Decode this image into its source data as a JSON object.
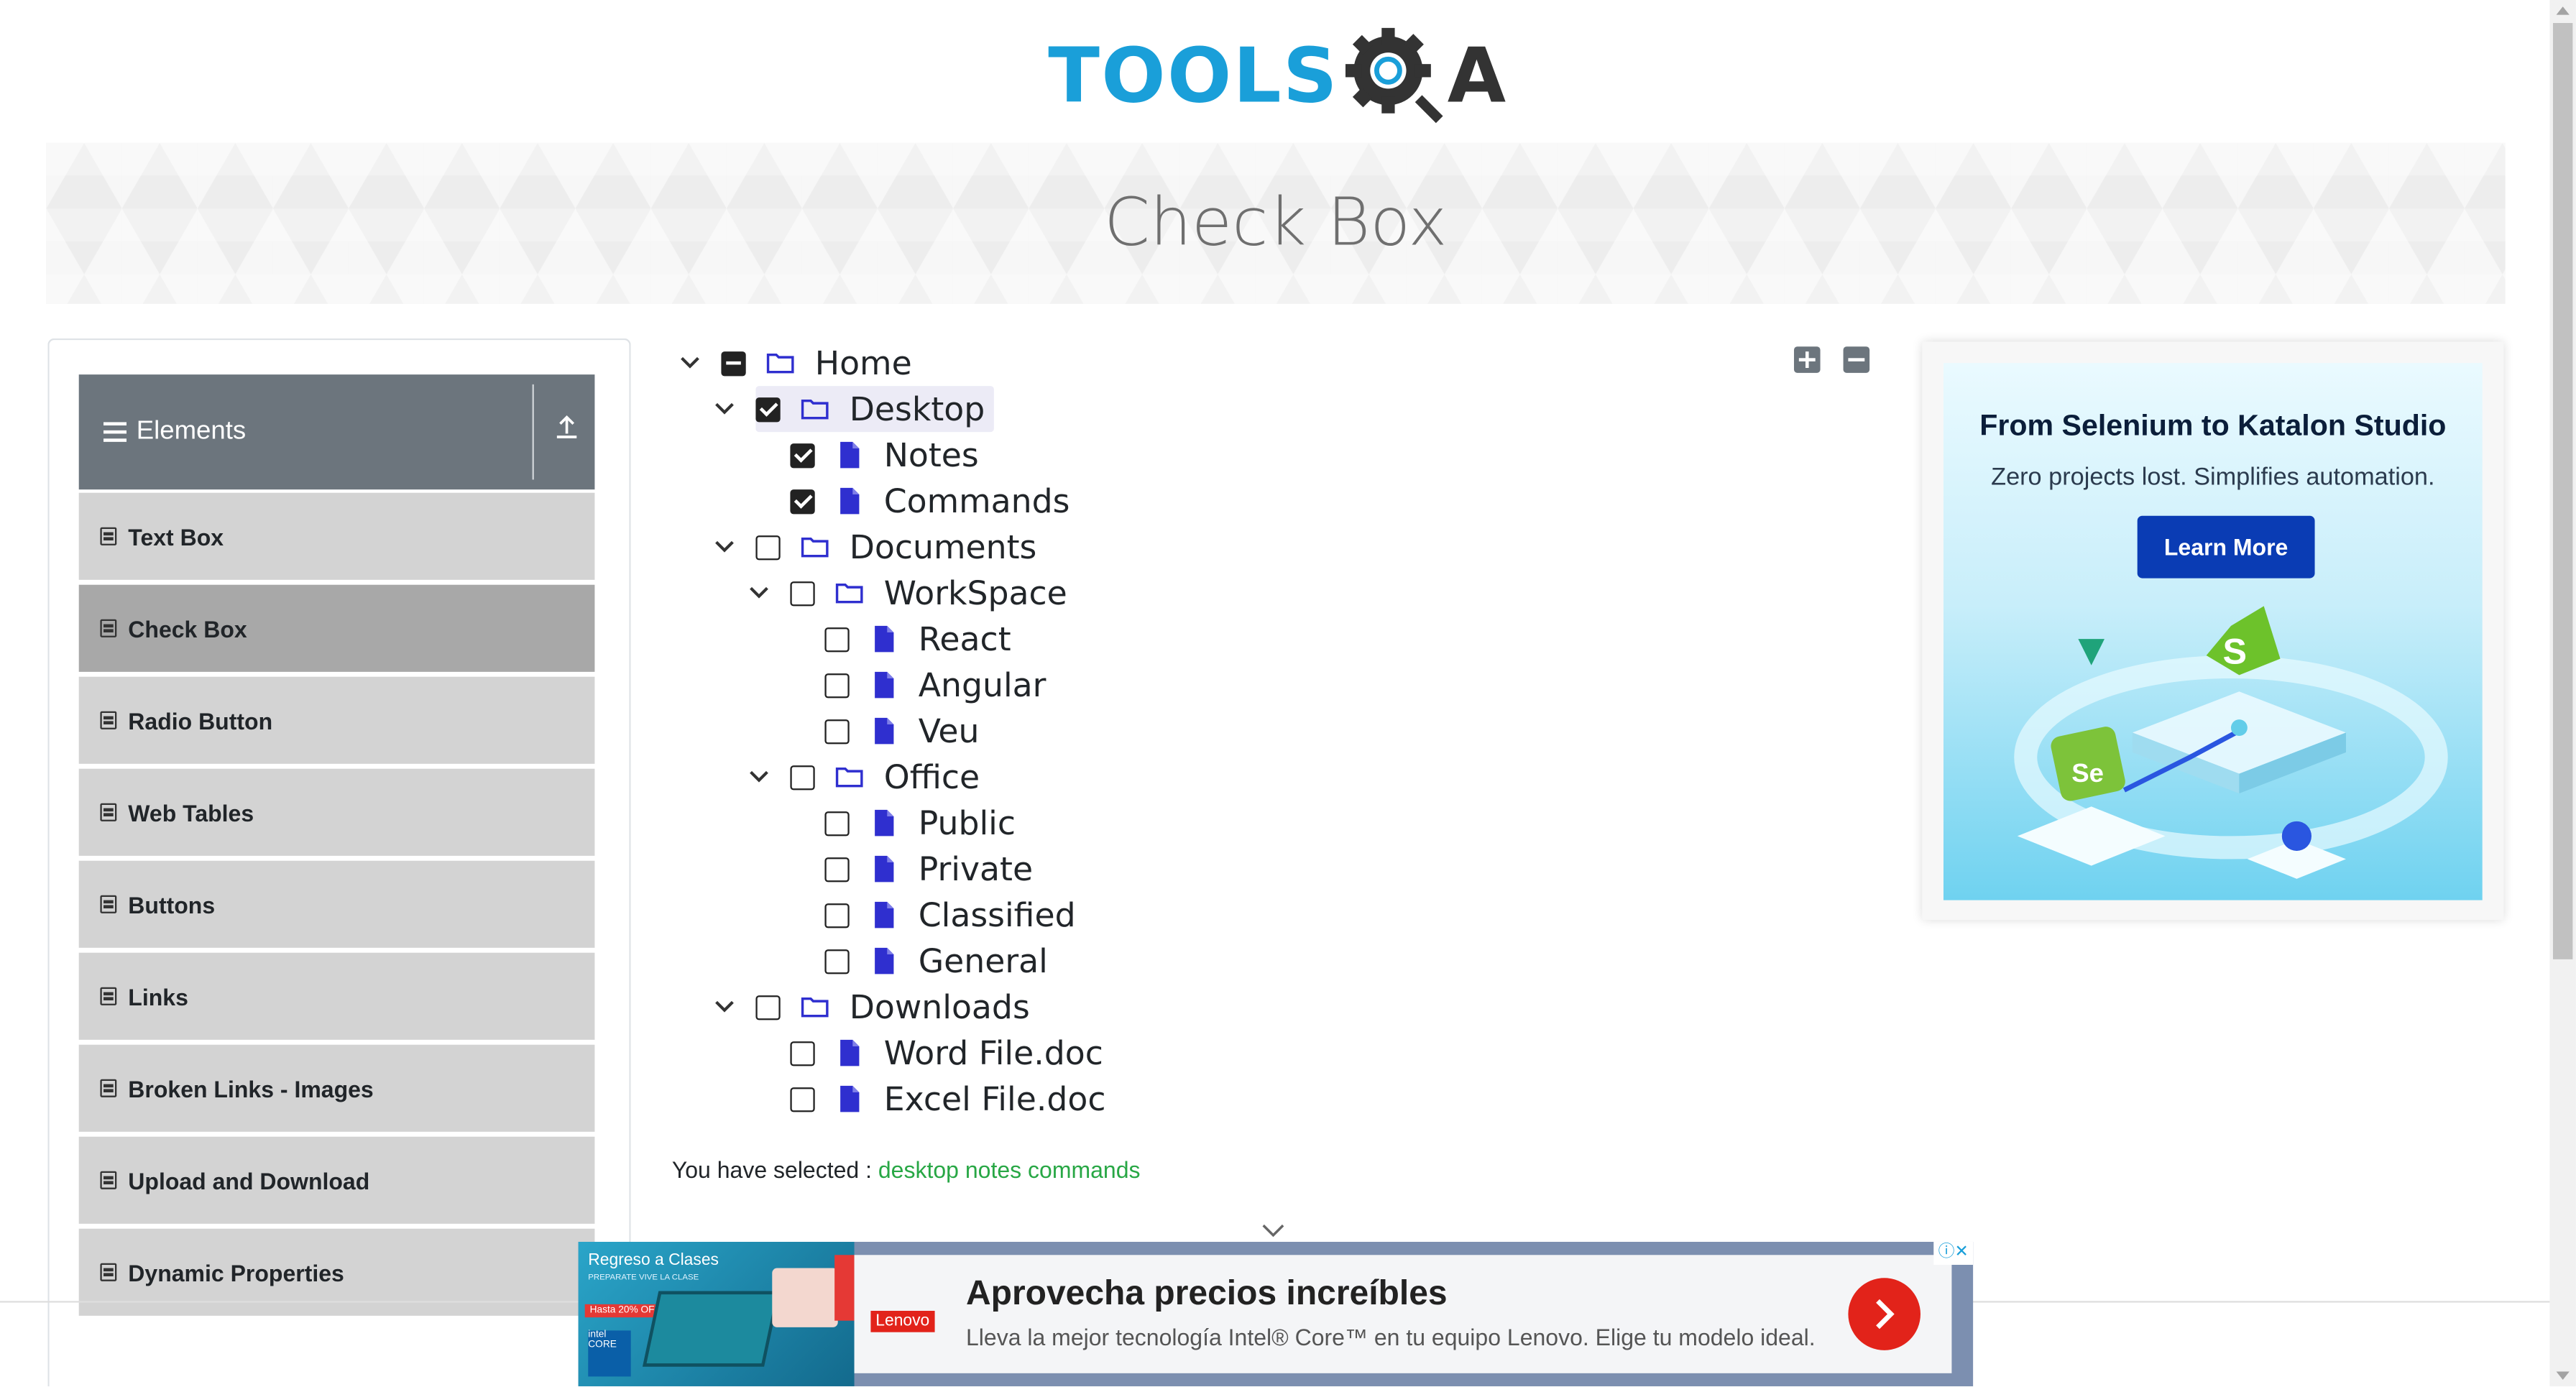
{
  "logo": {
    "tools": "TOOLS",
    "a": "A"
  },
  "banner": {
    "title": "Check Box"
  },
  "sidebar": {
    "header": "Elements",
    "items": [
      {
        "label": "Text Box",
        "active": false
      },
      {
        "label": "Check Box",
        "active": true
      },
      {
        "label": "Radio Button",
        "active": false
      },
      {
        "label": "Web Tables",
        "active": false
      },
      {
        "label": "Buttons",
        "active": false
      },
      {
        "label": "Links",
        "active": false
      },
      {
        "label": "Broken Links - Images",
        "active": false
      },
      {
        "label": "Upload and Download",
        "active": false
      },
      {
        "label": "Dynamic Properties",
        "active": false
      }
    ]
  },
  "tree": {
    "expand_all_icon": "plus-square-icon",
    "collapse_all_icon": "minus-square-icon",
    "nodes": [
      {
        "label": "Home",
        "depth": 0,
        "state": "half",
        "type": "folder",
        "expanded": true
      },
      {
        "label": "Desktop",
        "depth": 1,
        "state": "checked",
        "type": "folder",
        "expanded": true,
        "highlight": true
      },
      {
        "label": "Notes",
        "depth": 2,
        "state": "checked",
        "type": "file"
      },
      {
        "label": "Commands",
        "depth": 2,
        "state": "checked",
        "type": "file"
      },
      {
        "label": "Documents",
        "depth": 1,
        "state": "unchecked",
        "type": "folder",
        "expanded": true
      },
      {
        "label": "WorkSpace",
        "depth": 2,
        "state": "unchecked",
        "type": "folder",
        "expanded": true
      },
      {
        "label": "React",
        "depth": 3,
        "state": "unchecked",
        "type": "file"
      },
      {
        "label": "Angular",
        "depth": 3,
        "state": "unchecked",
        "type": "file"
      },
      {
        "label": "Veu",
        "depth": 3,
        "state": "unchecked",
        "type": "file"
      },
      {
        "label": "Office",
        "depth": 2,
        "state": "unchecked",
        "type": "folder",
        "expanded": true
      },
      {
        "label": "Public",
        "depth": 3,
        "state": "unchecked",
        "type": "file"
      },
      {
        "label": "Private",
        "depth": 3,
        "state": "unchecked",
        "type": "file"
      },
      {
        "label": "Classified",
        "depth": 3,
        "state": "unchecked",
        "type": "file"
      },
      {
        "label": "General",
        "depth": 3,
        "state": "unchecked",
        "type": "file"
      },
      {
        "label": "Downloads",
        "depth": 1,
        "state": "unchecked",
        "type": "folder",
        "expanded": true
      },
      {
        "label": "Word File.doc",
        "depth": 2,
        "state": "unchecked",
        "type": "file"
      },
      {
        "label": "Excel File.doc",
        "depth": 2,
        "state": "unchecked",
        "type": "file"
      }
    ]
  },
  "result": {
    "prefix": "You have selected :",
    "items": "desktop notes commands"
  },
  "ad_right": {
    "heading": "From Selenium to Katalon Studio",
    "sub": "Zero projects lost. Simplifies automation.",
    "button": "Learn More"
  },
  "ad_bottom": {
    "left_title": "Regreso a Clases",
    "left_sub": "PREPARATE VIVE LA CLASE",
    "discount": "Hasta 20% OFF",
    "chip": "intel CORE",
    "brand": "Lenovo",
    "title": "Aprovecha precios increíbles",
    "sub": "Lleva la mejor tecnología Intel® Core™ en tu equipo Lenovo. Elige tu modelo ideal.",
    "badge": "ⓘ✕"
  },
  "colors": {
    "accent": "#1a9fd9",
    "file_icon": "#2f2fcf",
    "selected_text": "#28a745",
    "sidebar_bg": "#6c757d"
  }
}
